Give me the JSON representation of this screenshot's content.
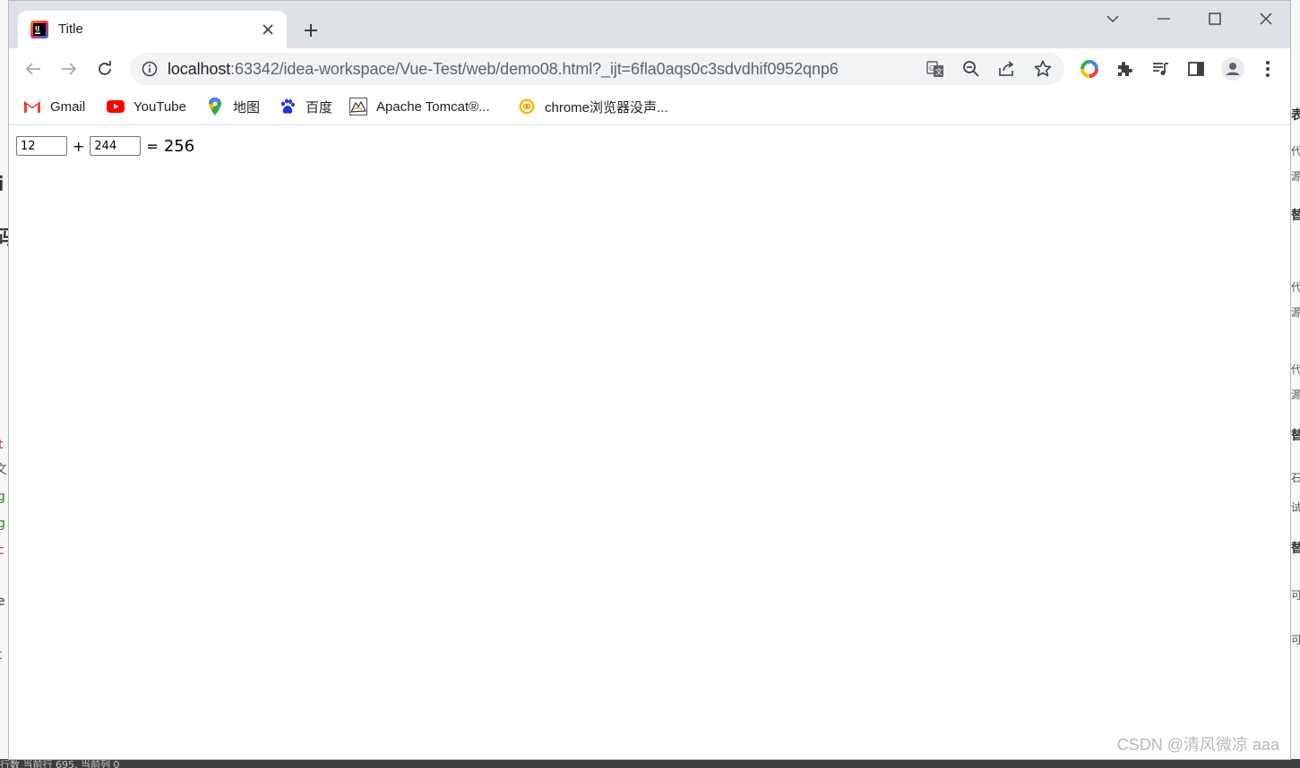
{
  "browser": {
    "tab": {
      "title": "Title",
      "favicon": "intellij-icon"
    },
    "newtab_icon": "plus-icon",
    "window_controls": [
      "chevron-down-icon",
      "minimize-icon",
      "maximize-icon",
      "close-icon"
    ],
    "nav": {
      "back_icon": "arrow-left-icon",
      "forward_icon": "arrow-right-icon",
      "reload_icon": "reload-icon"
    },
    "url": {
      "host": "localhost",
      "rest": ":63342/idea-workspace/Vue-Test/web/demo08.html?_ijt=6fla0aqs0c3sdvdhif0952qnp6"
    },
    "bookmarks": [
      {
        "label": "Gmail",
        "icon": "gmail-icon"
      },
      {
        "label": "YouTube",
        "icon": "youtube-icon"
      },
      {
        "label": "地图",
        "icon": "maps-icon"
      },
      {
        "label": "百度",
        "icon": "baidu-icon"
      },
      {
        "label": "Apache Tomcat®...",
        "icon": "tomcat-icon"
      },
      {
        "label": "chrome浏览器没声...",
        "icon": "chrome-extension-icon"
      }
    ]
  },
  "page": {
    "num1": "12",
    "plus": "+",
    "num2": "244",
    "equals": "=",
    "result": "256"
  },
  "watermark": "CSDN @清风微凉 aaa",
  "background": {
    "left_fragments": [
      "i",
      "码",
      "t",
      "文",
      "g",
      "g",
      "c",
      "e",
      "t"
    ],
    "right_fragments": [
      "表",
      "代",
      "源",
      "替",
      "代",
      "源",
      "代",
      "源",
      "替",
      "石",
      "试",
      "替",
      "可",
      "可"
    ],
    "status_text": "行数  当前行 695, 当前列 0"
  },
  "colors": {
    "tabstrip": "#dee1e6",
    "omnibox": "#f1f3f4",
    "youtube_red": "#ff0000"
  }
}
